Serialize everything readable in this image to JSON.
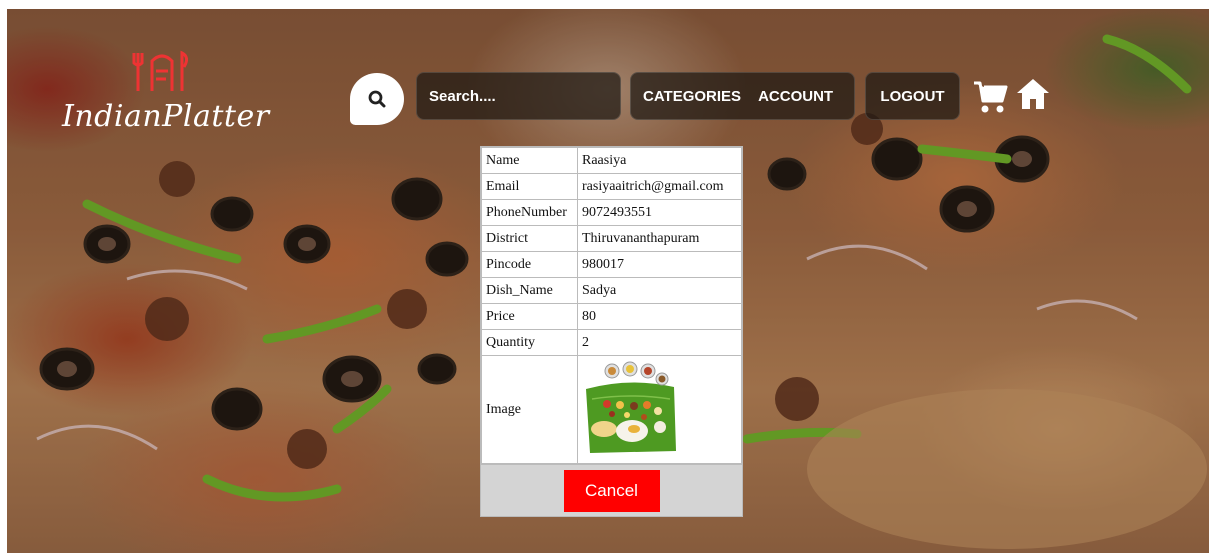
{
  "brand": {
    "name": "IndianPlatter"
  },
  "nav": {
    "search_placeholder": "Search....",
    "categories": "CATEGORIES",
    "account": "ACCOUNT",
    "logout": "LOGOUT"
  },
  "order": {
    "rows": [
      {
        "label": "Name",
        "value": "Raasiya"
      },
      {
        "label": "Email",
        "value": "rasiyaaitrich@gmail.com"
      },
      {
        "label": "PhoneNumber",
        "value": "9072493551"
      },
      {
        "label": "District",
        "value": "Thiruvananthapuram"
      },
      {
        "label": "Pincode",
        "value": "980017"
      },
      {
        "label": "Dish_Name",
        "value": "Sadya"
      },
      {
        "label": "Price",
        "value": "80"
      },
      {
        "label": "Quantity",
        "value": "2"
      }
    ],
    "image_label": "Image",
    "cancel_label": "Cancel"
  },
  "colors": {
    "cancel": "#ff0000",
    "footer": "#d4d4d4",
    "pill": "#1e1914"
  },
  "icons": [
    "search-icon",
    "cart-icon",
    "home-icon",
    "logo-icon"
  ]
}
